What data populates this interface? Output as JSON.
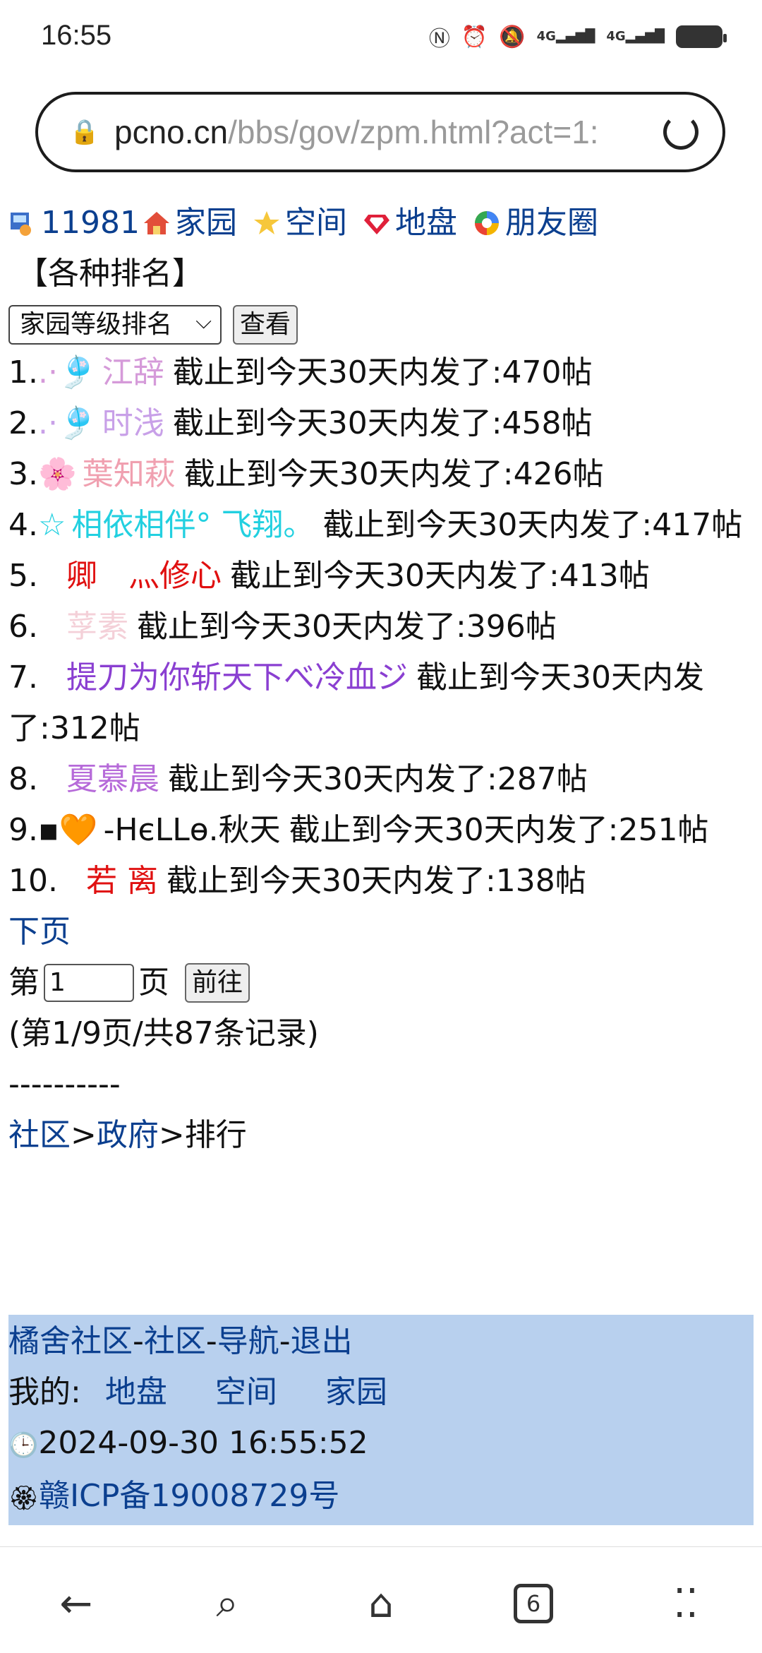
{
  "status": {
    "time": "16:55",
    "net1": "4G",
    "net2": "4G"
  },
  "browser": {
    "url_host": "pcno.cn",
    "url_path": "/bbs/gov/zpm.html?act=1:",
    "tabs_count": "6"
  },
  "nav": {
    "id": "11981",
    "home": "家园",
    "space": "空间",
    "territory": "地盘",
    "friends": "朋友圈"
  },
  "section_title": "【各种排名】",
  "ranking_select": "家园等级排名",
  "view_button": "查看",
  "rankings": [
    {
      "num": "1.",
      "name": ".·🎐",
      "name2": "江辞",
      "text": "截止到今天30天内发了:470帖",
      "color": "#d59ad9"
    },
    {
      "num": "2.",
      "name": ".·🎐",
      "name2": "时浅",
      "text": "截止到今天30天内发了:458帖",
      "color": "#c8a0e8"
    },
    {
      "num": "3.",
      "name": "🌸",
      "name2": "葉知萩",
      "text": "截止到今天30天内发了:426帖",
      "color": "#f0a0b0"
    },
    {
      "num": "4.",
      "name": "☆",
      "name2": "相依相伴° 飞翔。",
      "text": "截止到今天30天内发了:417帖",
      "color": "#22d0e0"
    },
    {
      "num": "5.",
      "name": "",
      "name2": "卿　灬修心",
      "text": "截止到今天30天内发了:413帖",
      "color": "#e01010"
    },
    {
      "num": "6.",
      "name": "",
      "name2": "莩素",
      "text": "截止到今天30天内发了:396帖",
      "color": "#f4d0d8"
    },
    {
      "num": "7.",
      "name": "",
      "name2": "提刀为你斩天下べ冷血ジ",
      "text": "截止到今天30天内发了:312帖",
      "color": "#8a3fd1"
    },
    {
      "num": "8.",
      "name": "",
      "name2": "夏慕晨",
      "text": "截止到今天30天内发了:287帖",
      "color": "#b66ad9"
    },
    {
      "num": "9.",
      "name": "▪🧡",
      "name2": "-HєLLө.秋天",
      "text": "截止到今天30天内发了:251帖",
      "color": "#111111"
    },
    {
      "num": "10.",
      "name": "",
      "name2": "若 离",
      "text": "截止到今天30天内发了:138帖",
      "color": "#e01010"
    }
  ],
  "next_page": "下页",
  "pager": {
    "prefix": "第",
    "value": "1",
    "suffix": "页",
    "go": "前往"
  },
  "record_info": "(第1/9页/共87条记录)",
  "divider": "----------",
  "breadcrumb": {
    "a": "社区",
    "sep1": ">",
    "b": "政府",
    "sep2": ">",
    "c": "排行"
  },
  "footer": {
    "l1a": "橘舍社区",
    "l1b": "社区",
    "l1c": "导航",
    "l1d": "退出",
    "mine": "我的:",
    "m1": "地盘",
    "m2": "空间",
    "m3": "家园",
    "datetime": "2024-09-30 16:55:52",
    "icp": "赣ICP备19008729号"
  }
}
